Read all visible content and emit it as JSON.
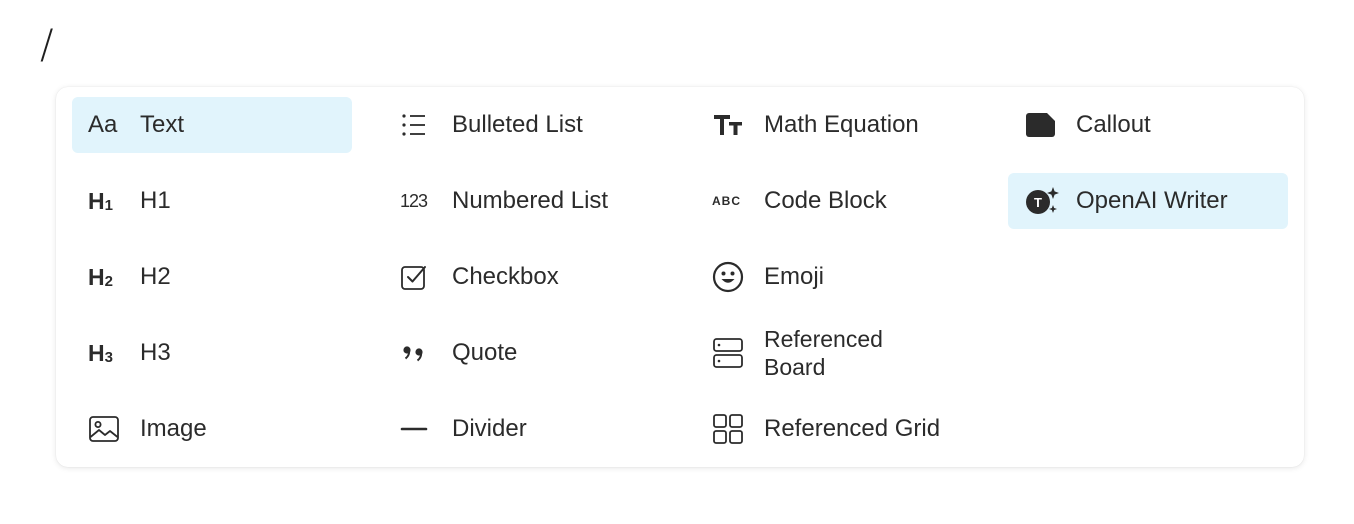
{
  "editor": {
    "slash_text": "/"
  },
  "menu": {
    "columns": [
      [
        {
          "label": "Text",
          "icon": "text-aa-icon",
          "selected": true
        },
        {
          "label": "H1",
          "icon": "heading-1-icon"
        },
        {
          "label": "H2",
          "icon": "heading-2-icon"
        },
        {
          "label": "H3",
          "icon": "heading-3-icon"
        },
        {
          "label": "Image",
          "icon": "image-icon"
        }
      ],
      [
        {
          "label": "Bulleted List",
          "icon": "bulleted-list-icon"
        },
        {
          "label": "Numbered List",
          "icon": "numbered-list-icon"
        },
        {
          "label": "Checkbox",
          "icon": "checkbox-icon"
        },
        {
          "label": "Quote",
          "icon": "quote-icon"
        },
        {
          "label": "Divider",
          "icon": "divider-icon"
        }
      ],
      [
        {
          "label": "Math Equation",
          "icon": "math-equation-icon"
        },
        {
          "label": "Code Block",
          "icon": "code-block-icon"
        },
        {
          "label": "Emoji",
          "icon": "emoji-icon"
        },
        {
          "label": "Referenced\nBoard",
          "icon": "referenced-board-icon"
        },
        {
          "label": "Referenced Grid",
          "icon": "referenced-grid-icon"
        }
      ],
      [
        {
          "label": "Callout",
          "icon": "callout-icon"
        },
        {
          "label": "OpenAI Writer",
          "icon": "openai-writer-icon",
          "selected": true
        }
      ]
    ],
    "icon_glyphs": {
      "h1": "H",
      "h1_sub": "1",
      "h2": "H",
      "h2_sub": "2",
      "h3": "H",
      "h3_sub": "3",
      "aa": "Aa",
      "numbered": "123",
      "code": "ABC",
      "math": "TT",
      "openai": "T"
    },
    "colors": {
      "selected_bg": "#e1f4fc",
      "text": "#2b2b2b",
      "icon": "#2b2b2b"
    }
  }
}
